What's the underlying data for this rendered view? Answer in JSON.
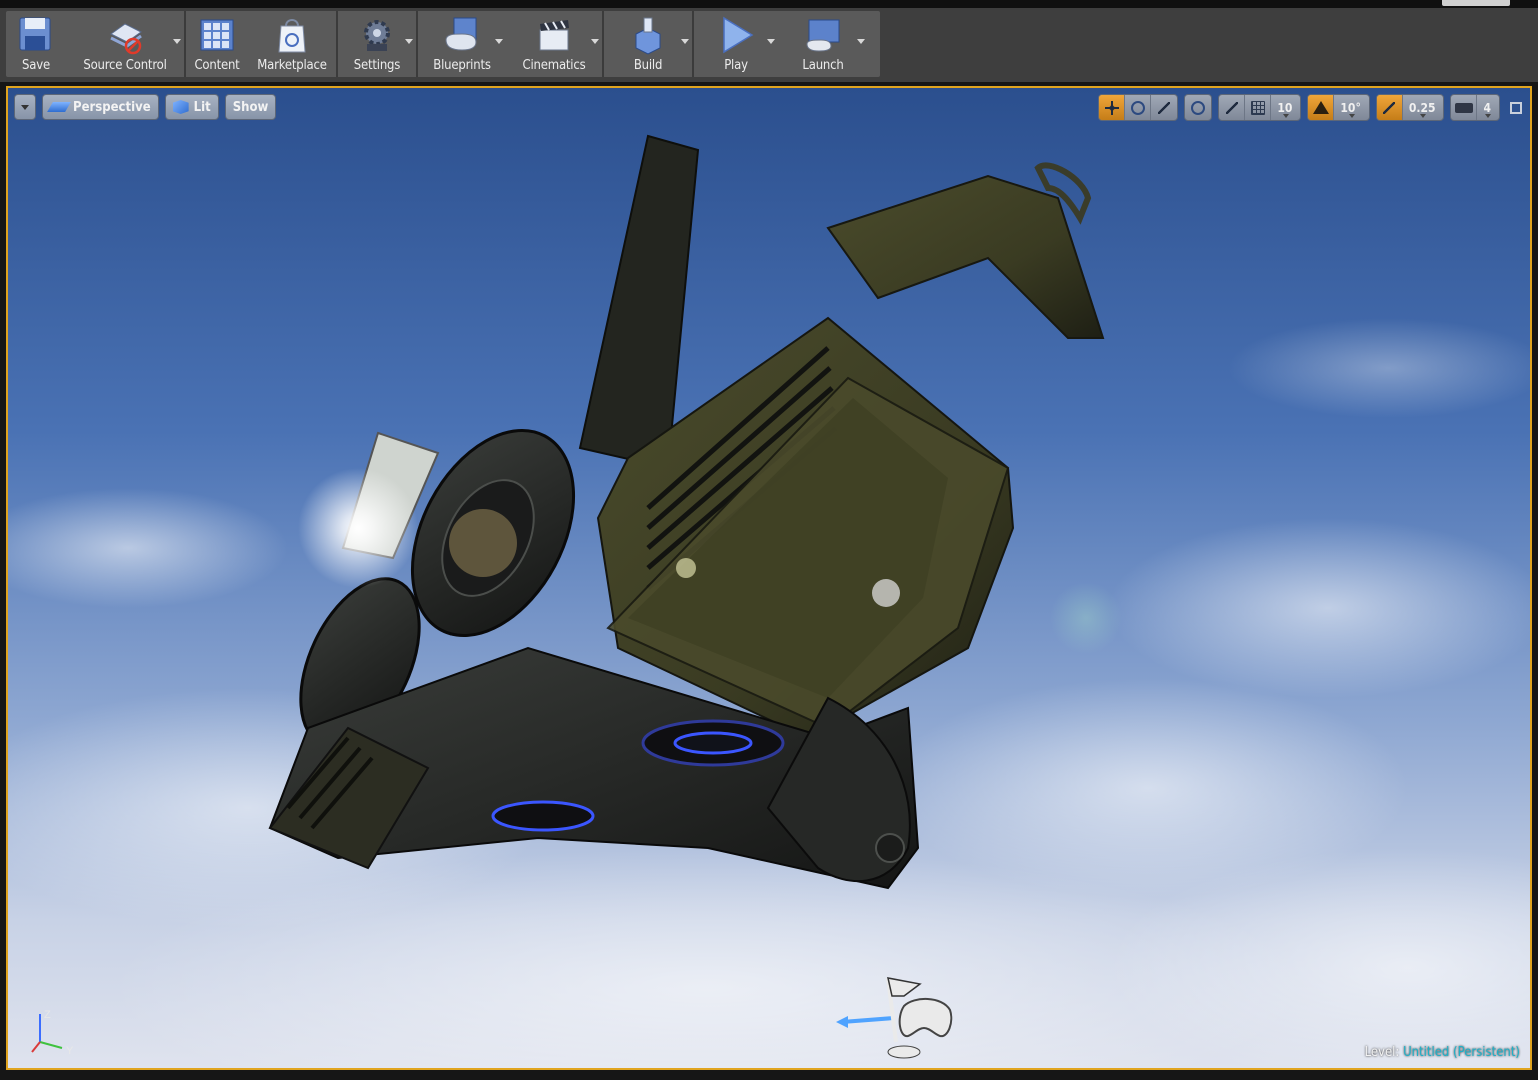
{
  "toolbar": {
    "buttons": [
      {
        "id": "save",
        "label": "Save",
        "icon": "save-icon",
        "caret": false
      },
      {
        "id": "source-control",
        "label": "Source Control",
        "icon": "source-control-icon",
        "caret": true
      },
      {
        "id": "content",
        "label": "Content",
        "icon": "content-icon",
        "caret": false
      },
      {
        "id": "marketplace",
        "label": "Marketplace",
        "icon": "marketplace-icon",
        "caret": false
      },
      {
        "id": "settings",
        "label": "Settings",
        "icon": "settings-gear-icon",
        "caret": true
      },
      {
        "id": "blueprints",
        "label": "Blueprints",
        "icon": "blueprints-icon",
        "caret": true
      },
      {
        "id": "cinematics",
        "label": "Cinematics",
        "icon": "clapperboard-icon",
        "caret": true
      },
      {
        "id": "build",
        "label": "Build",
        "icon": "build-icon",
        "caret": true
      },
      {
        "id": "play",
        "label": "Play",
        "icon": "play-icon",
        "caret": true
      },
      {
        "id": "launch",
        "label": "Launch",
        "icon": "launch-icon",
        "caret": true
      }
    ]
  },
  "viewport": {
    "left_controls": {
      "perspective_label": "Perspective",
      "lit_label": "Lit",
      "show_label": "Show"
    },
    "right_controls": {
      "grid_snap_value": "10",
      "rotation_snap_value": "10°",
      "scale_snap_value": "0.25",
      "camera_speed_value": "4"
    },
    "level_label": "Level:",
    "level_name": "Untitled (Persistent)",
    "axis_labels": {
      "z": "Z",
      "y": "Y"
    },
    "accent_border_color": "#e0a41f"
  }
}
